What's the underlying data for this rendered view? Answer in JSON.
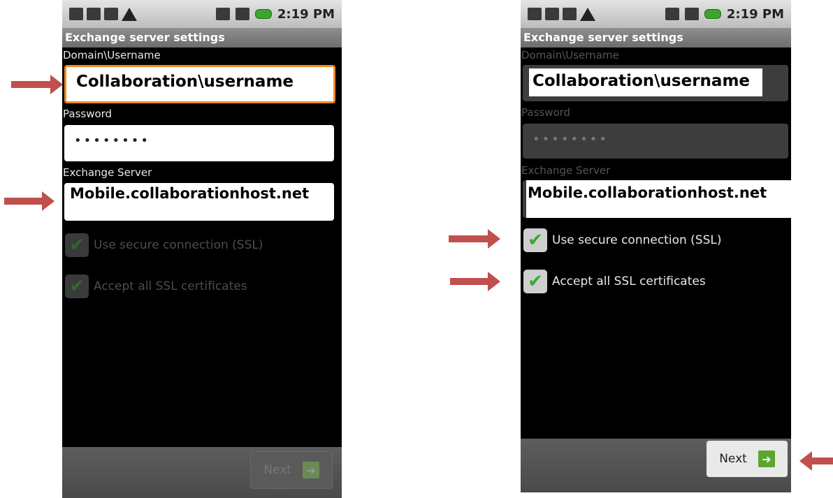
{
  "screen": {
    "status_time": "2:19 PM",
    "title": "Exchange server settings",
    "domain_label": "Domain\\Username",
    "domain_value": "Collaboration\\username",
    "password_label": "Password",
    "password_value": "••••••••",
    "server_label": "Exchange Server",
    "server_value": "Mobile.collaborationhost.net",
    "ssl_label": "Use secure connection (SSL)",
    "accept_label": "Accept all SSL certificates",
    "next_label": "Next"
  },
  "colors": {
    "focus": "#f08a24",
    "arrow": "#c0504d",
    "check": "#3aa832"
  },
  "icons": [
    "status-icons",
    "warning-icon",
    "signal-icon",
    "battery-icon",
    "check-icon",
    "arrow-right-icon"
  ]
}
